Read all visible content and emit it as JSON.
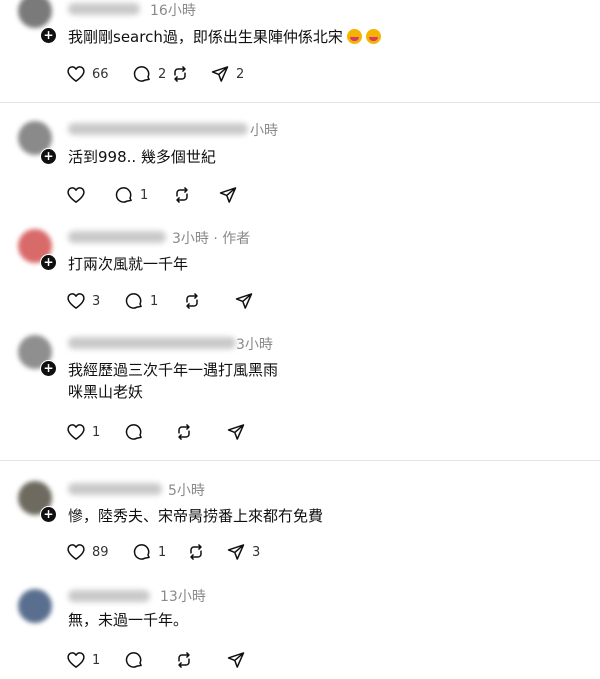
{
  "comments": [
    {
      "time": "16小時",
      "text": "我剛剛search過，即係出生果陣仲係北宋",
      "emoji": true,
      "likes": "66",
      "replies": "2",
      "reposts": "",
      "shares": "2",
      "avatar_color": "#7a7a7a"
    },
    {
      "time": "小時",
      "text": "活到998.. 幾多個世紀",
      "emoji": false,
      "likes": "",
      "replies": "1",
      "reposts": "",
      "shares": "",
      "avatar_color": "#8a8a8a"
    },
    {
      "time": "3小時 · 作者",
      "text": "打兩次風就一千年",
      "emoji": false,
      "likes": "3",
      "replies": "1",
      "reposts": "",
      "shares": "",
      "avatar_color": "#d96a6a"
    },
    {
      "time": "3小時",
      "text": "我經歷過三次千年一遇打風黑雨\n咪黑山老妖",
      "emoji": false,
      "likes": "1",
      "replies": "",
      "reposts": "",
      "shares": "",
      "avatar_color": "#8f8f8f"
    },
    {
      "time": "5小時",
      "text": "慘，陸秀夫、宋帝昺捞番上來都冇免費",
      "emoji": false,
      "likes": "89",
      "replies": "1",
      "reposts": "",
      "shares": "3",
      "avatar_color": "#6f6a60"
    },
    {
      "time": "13小時",
      "text": "無，未過一千年。",
      "emoji": false,
      "likes": "1",
      "replies": "",
      "reposts": "",
      "shares": "",
      "avatar_color": "#5a6f8f"
    }
  ],
  "icons": {
    "like": "heart-icon",
    "reply": "comment-bubble-icon",
    "repost": "repost-icon",
    "share": "send-icon",
    "follow": "plus-icon"
  },
  "colors": {
    "text": "#101010",
    "meta": "#8a8a8a",
    "divider": "#e4e4e4"
  }
}
